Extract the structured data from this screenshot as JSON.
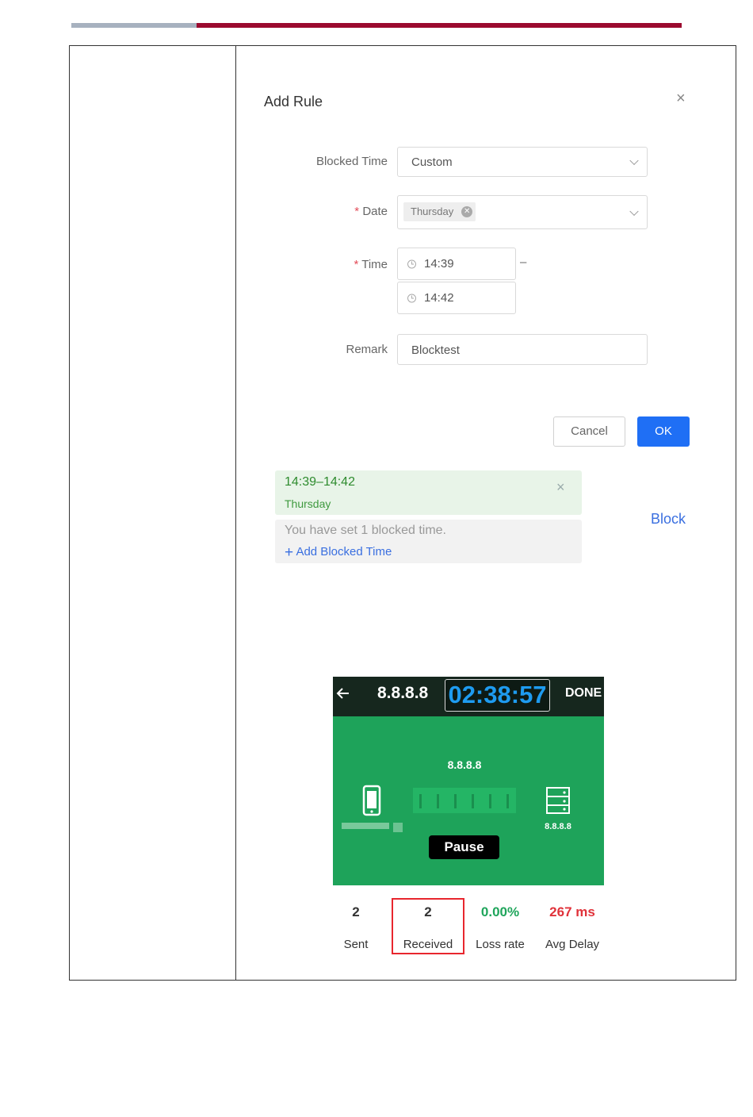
{
  "dialog": {
    "title": "Add Rule",
    "close_glyph": "×",
    "blocked_time_label": "Blocked Time",
    "blocked_time_value": "Custom",
    "date_label": "Date",
    "date_tag": "Thursday",
    "time_label": "Time",
    "time_start": "14:39",
    "time_sep": "–",
    "time_end": "14:42",
    "remark_label": "Remark",
    "remark_value": "Blocktest",
    "required_mark": "*",
    "cancel_label": "Cancel",
    "ok_label": "OK"
  },
  "blocked": {
    "range": "14:39–14:42",
    "day": "Thursday",
    "info": "You have set 1 blocked time.",
    "add_label": "Add Blocked Time",
    "action_label": "Block"
  },
  "ping": {
    "target": "8.8.8.8",
    "timer": "02:38:57",
    "done_label": "DONE",
    "host_label": "8.8.8.8",
    "server_label": "8.8.8.8",
    "pause_label": "Pause",
    "stats": [
      {
        "value": "2",
        "label": "Sent",
        "color": "#222222"
      },
      {
        "value": "2",
        "label": "Received",
        "color": "#222222"
      },
      {
        "value": "0.00%",
        "label": "Loss rate",
        "color": "#1fa55b"
      },
      {
        "value": "267 ms",
        "label": "Avg Delay",
        "color": "#e0323a"
      }
    ]
  },
  "colors": {
    "header_gray": "#a7b1bf",
    "header_red": "#9b0a2f",
    "primary": "#1f6ff5",
    "ping_green": "#1ea35a",
    "highlight_red": "#e8262e"
  }
}
